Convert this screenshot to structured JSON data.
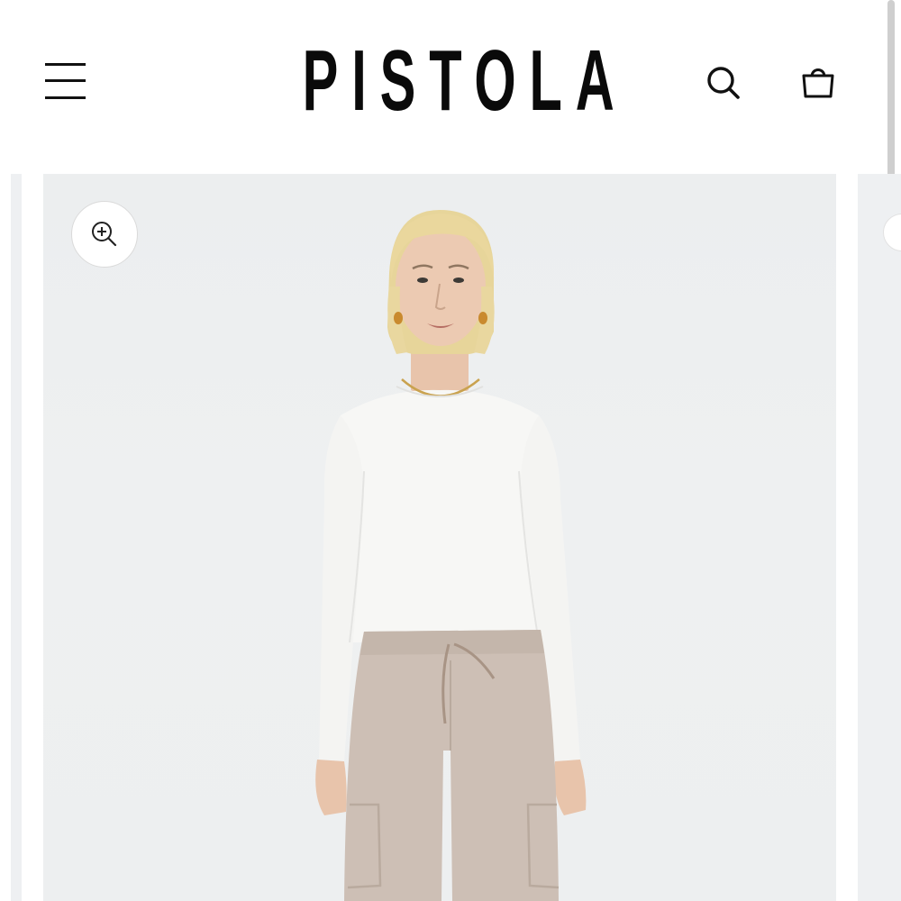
{
  "header": {
    "logo_text": "PISTOLA",
    "menu_icon": "hamburger-menu-icon",
    "search_icon": "search-icon",
    "bag_icon": "shopping-bag-icon"
  },
  "gallery": {
    "zoom_icon": "zoom-in-icon",
    "image_subject": "model-white-top-beige-cargo-pants"
  },
  "colors": {
    "logo": "#0a0a0a",
    "image_background": "#eef0f1",
    "top": "#f7f7f5",
    "pants": "#cdbfb5",
    "hair": "#e7d59a"
  }
}
